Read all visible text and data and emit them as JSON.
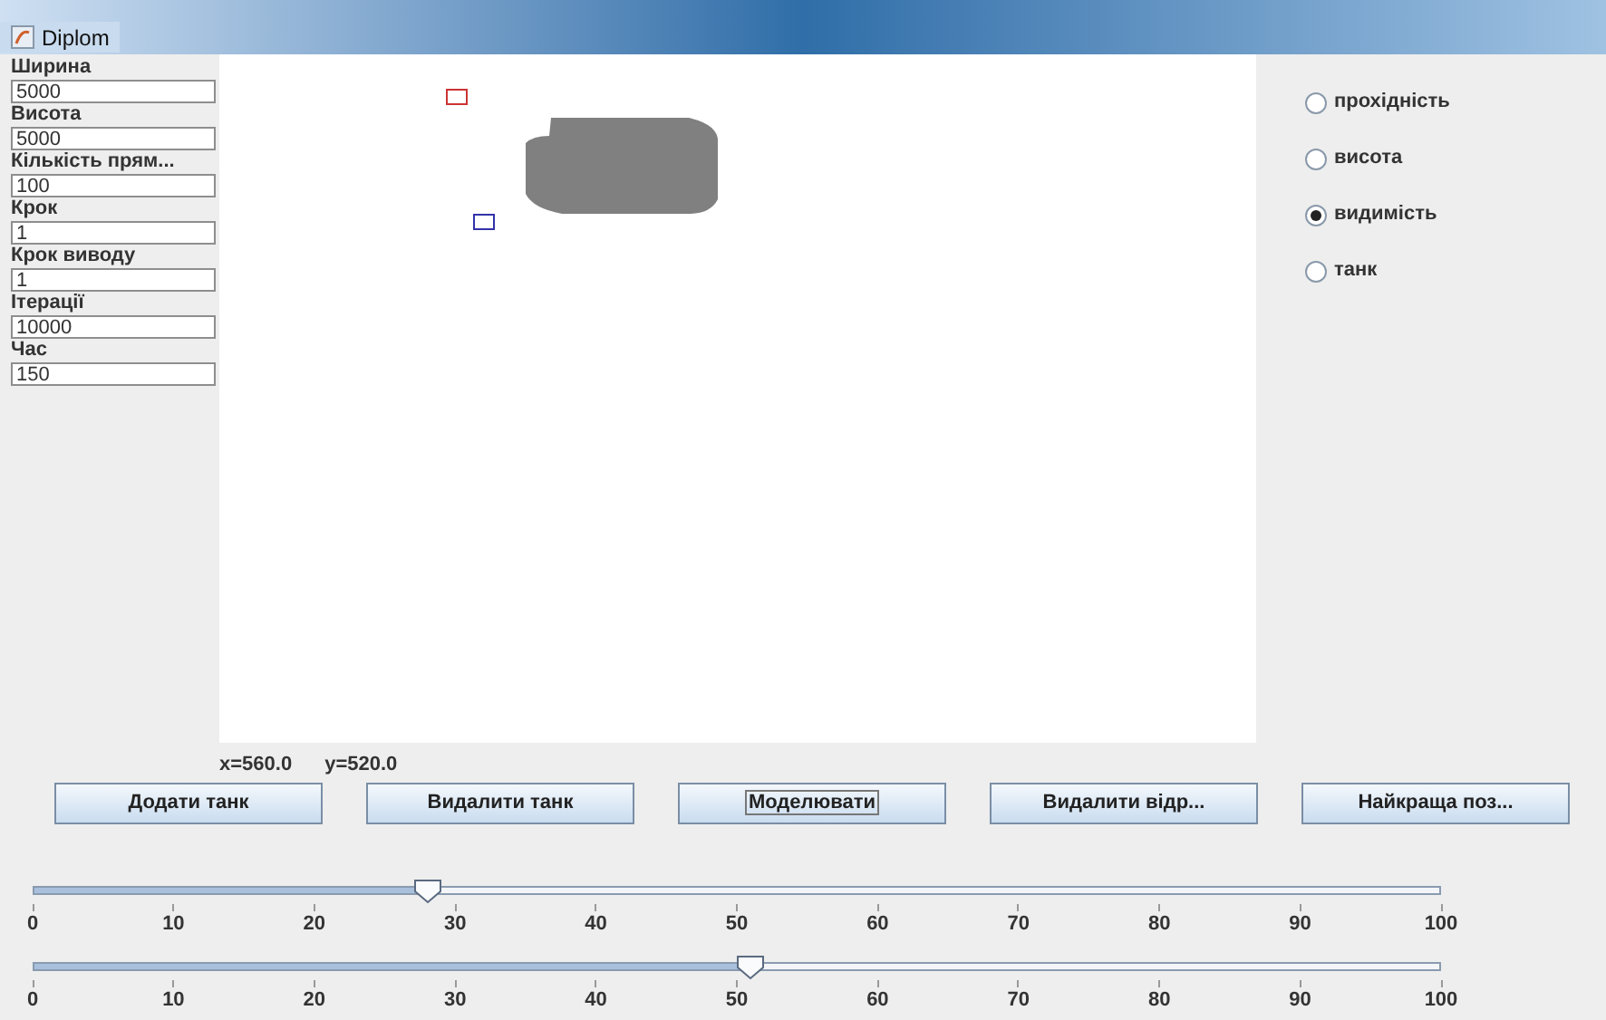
{
  "window": {
    "title": "Diplom"
  },
  "fields": [
    {
      "label": "Ширина",
      "value": "5000"
    },
    {
      "label": "Висота",
      "value": "5000"
    },
    {
      "label": "Кількість прям...",
      "value": "100"
    },
    {
      "label": "Крок",
      "value": "1"
    },
    {
      "label": "Крок виводу",
      "value": "1"
    },
    {
      "label": "Ітерації",
      "value": "10000"
    },
    {
      "label": "Час",
      "value": "150"
    }
  ],
  "canvas": {
    "markers": [
      {
        "kind": "start",
        "color": "#cc3333"
      },
      {
        "kind": "end",
        "color": "#3333aa"
      }
    ]
  },
  "radios": [
    {
      "label": "прохідність",
      "selected": false
    },
    {
      "label": "висота",
      "selected": false
    },
    {
      "label": "видимість",
      "selected": true
    },
    {
      "label": "танк",
      "selected": false
    }
  ],
  "coords": {
    "x": "x=560.0",
    "y": "y=520.0"
  },
  "buttons": [
    {
      "label": "Додати танк",
      "focused": false
    },
    {
      "label": "Видалити танк",
      "focused": false
    },
    {
      "label": "Моделювати",
      "focused": true
    },
    {
      "label": "Видалити відр...",
      "focused": false
    },
    {
      "label": "Найкраща поз...",
      "focused": false
    }
  ],
  "sliders": [
    {
      "level": 0.28,
      "ticks": [
        "0",
        "10",
        "20",
        "30",
        "40",
        "50",
        "60",
        "70",
        "80",
        "90",
        "100"
      ]
    },
    {
      "level": 0.51,
      "ticks": [
        "0",
        "10",
        "20",
        "30",
        "40",
        "50",
        "60",
        "70",
        "80",
        "90",
        "100"
      ]
    }
  ]
}
